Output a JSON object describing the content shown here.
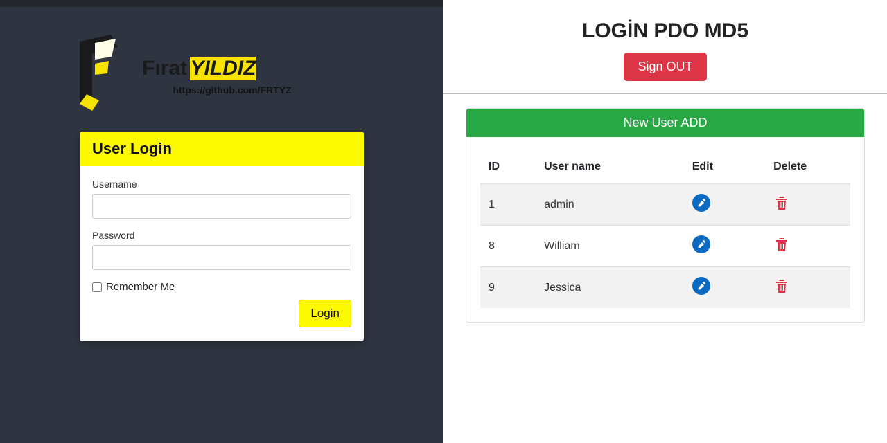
{
  "brand": {
    "name1": "Fırat",
    "name2": "YILDIZ",
    "url": "https://github.com/FRTYZ"
  },
  "login": {
    "head": "User Login",
    "username_label": "Username",
    "password_label": "Password",
    "remember_label": "Remember Me",
    "login_btn": "Login"
  },
  "admin": {
    "title": "LOGİN PDO MD5",
    "signout": "Sign OUT",
    "new_user": "New User ADD",
    "columns": {
      "id": "ID",
      "username": "User name",
      "edit": "Edit",
      "delete": "Delete"
    },
    "rows": [
      {
        "id": "1",
        "username": "admin"
      },
      {
        "id": "8",
        "username": "William"
      },
      {
        "id": "9",
        "username": "Jessica"
      }
    ]
  }
}
